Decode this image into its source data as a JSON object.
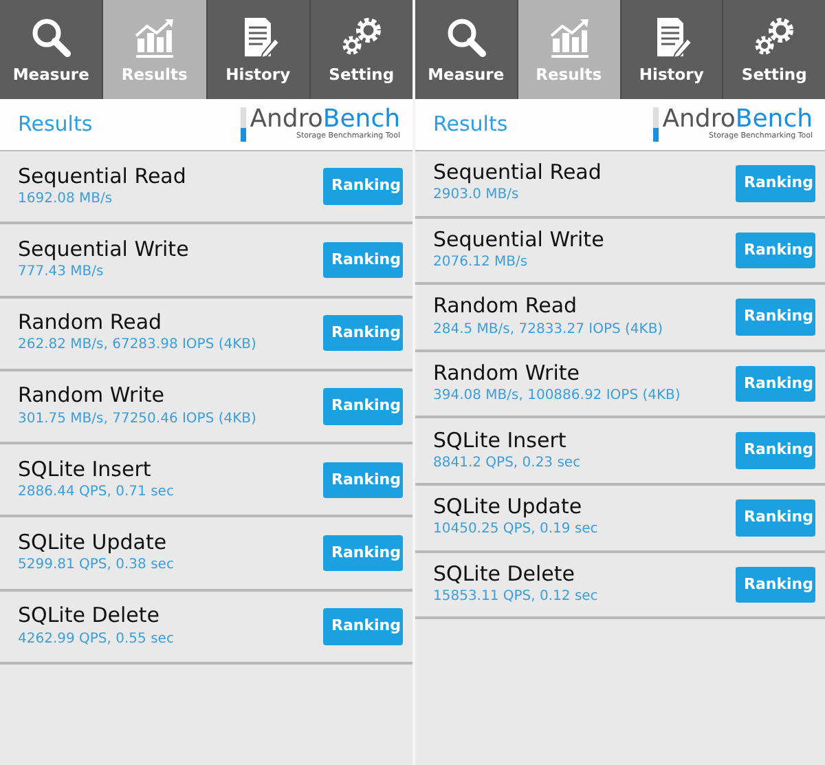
{
  "screens": [
    {
      "tabs": [
        {
          "label": "Measure",
          "kind": "search",
          "selected": false
        },
        {
          "label": "Results",
          "kind": "chart",
          "selected": true
        },
        {
          "label": "History",
          "kind": "document",
          "selected": false
        },
        {
          "label": "Setting",
          "kind": "gears",
          "selected": false
        }
      ],
      "header": {
        "title": "Results",
        "logo_start": "Andro",
        "logo_end": "Bench",
        "tagline": "Storage Benchmarking Tool"
      },
      "results": [
        {
          "name": "Sequential Read",
          "value": "1692.08 MB/s",
          "button": "Ranking"
        },
        {
          "name": "Sequential Write",
          "value": "777.43 MB/s",
          "button": "Ranking"
        },
        {
          "name": "Random Read",
          "value": "262.82 MB/s, 67283.98 IOPS (4KB)",
          "button": "Ranking"
        },
        {
          "name": "Random Write",
          "value": "301.75 MB/s, 77250.46 IOPS (4KB)",
          "button": "Ranking"
        },
        {
          "name": "SQLite Insert",
          "value": "2886.44 QPS, 0.71 sec",
          "button": "Ranking"
        },
        {
          "name": "SQLite Update",
          "value": "5299.81 QPS, 0.38 sec",
          "button": "Ranking"
        },
        {
          "name": "SQLite Delete",
          "value": "4262.99 QPS, 0.55 sec",
          "button": "Ranking"
        }
      ]
    },
    {
      "tabs": [
        {
          "label": "Measure",
          "kind": "search",
          "selected": false
        },
        {
          "label": "Results",
          "kind": "chart",
          "selected": true
        },
        {
          "label": "History",
          "kind": "document",
          "selected": false
        },
        {
          "label": "Setting",
          "kind": "gears",
          "selected": false
        }
      ],
      "header": {
        "title": "Results",
        "logo_start": "Andro",
        "logo_end": "Bench",
        "tagline": "Storage Benchmarking Tool"
      },
      "results": [
        {
          "name": "Sequential Read",
          "value": "2903.0 MB/s",
          "button": "Ranking"
        },
        {
          "name": "Sequential Write",
          "value": "2076.12 MB/s",
          "button": "Ranking"
        },
        {
          "name": "Random Read",
          "value": "284.5 MB/s, 72833.27 IOPS (4KB)",
          "button": "Ranking"
        },
        {
          "name": "Random Write",
          "value": "394.08 MB/s, 100886.92 IOPS (4KB)",
          "button": "Ranking"
        },
        {
          "name": "SQLite Insert",
          "value": "8841.2 QPS, 0.23 sec",
          "button": "Ranking"
        },
        {
          "name": "SQLite Update",
          "value": "10450.25 QPS, 0.19 sec",
          "button": "Ranking"
        },
        {
          "name": "SQLite Delete",
          "value": "15853.11 QPS, 0.12 sec",
          "button": "Ranking"
        }
      ]
    }
  ]
}
